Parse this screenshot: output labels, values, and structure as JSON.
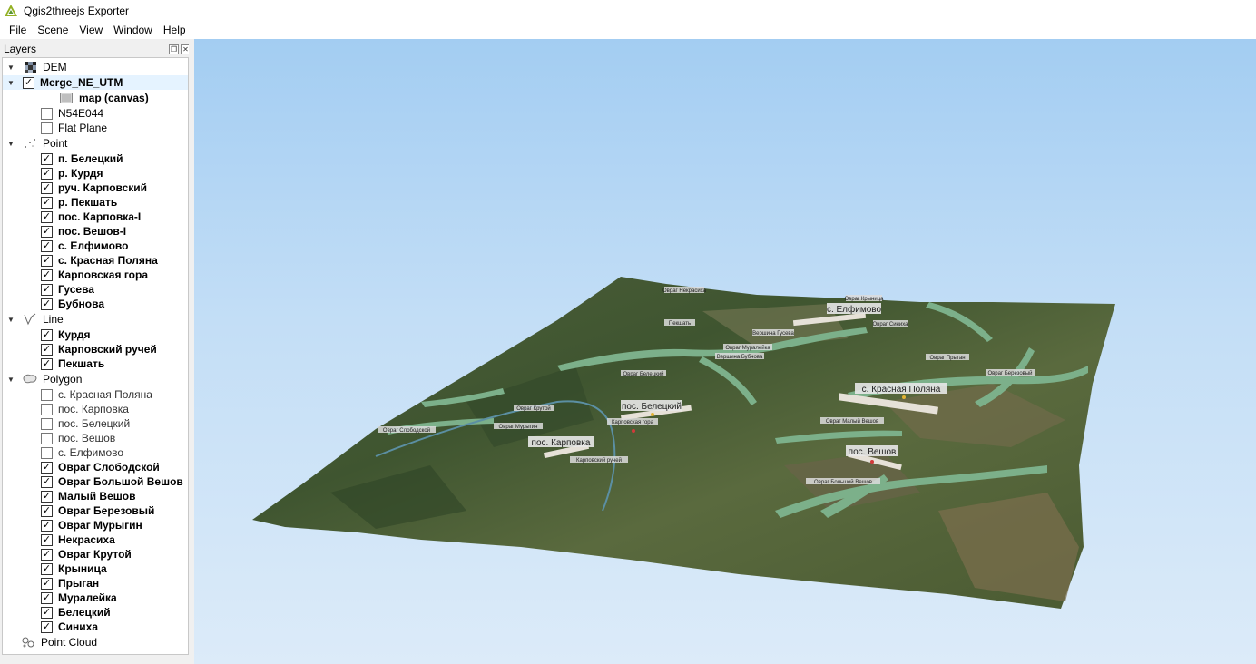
{
  "window": {
    "title": "Qgis2threejs Exporter"
  },
  "menu": [
    "File",
    "Scene",
    "View",
    "Window",
    "Help"
  ],
  "layers_panel": {
    "title": "Layers",
    "groups": {
      "dem": {
        "label": "DEM",
        "layers": [
          {
            "label": "Merge_NE_UTM",
            "checked": true,
            "bold": true,
            "selected": true
          },
          {
            "label": "map (canvas)",
            "bold": true,
            "child": true
          },
          {
            "label": "N54E044",
            "checked": false
          },
          {
            "label": "Flat Plane",
            "checked": false
          }
        ]
      },
      "point": {
        "label": "Point",
        "layers": [
          {
            "label": "п. Белецкий",
            "checked": true
          },
          {
            "label": "р. Курдя",
            "checked": true
          },
          {
            "label": "руч. Карповский",
            "checked": true
          },
          {
            "label": "р. Пекшать",
            "checked": true
          },
          {
            "label": "пос. Карповка-I",
            "checked": true
          },
          {
            "label": "пос. Вешов-I",
            "checked": true
          },
          {
            "label": "с. Елфимово",
            "checked": true
          },
          {
            "label": "с. Красная Поляна",
            "checked": true
          },
          {
            "label": "Карповская гора",
            "checked": true
          },
          {
            "label": "Гусева",
            "checked": true
          },
          {
            "label": "Бубнова",
            "checked": true
          }
        ]
      },
      "line": {
        "label": "Line",
        "layers": [
          {
            "label": "Курдя",
            "checked": true
          },
          {
            "label": "Карповский ручей",
            "checked": true
          },
          {
            "label": "Пекшать",
            "checked": true
          }
        ]
      },
      "polygon": {
        "label": "Polygon",
        "layers": [
          {
            "label": "с. Красная Поляна",
            "checked": false
          },
          {
            "label": "пос. Карповка",
            "checked": false
          },
          {
            "label": "пос. Белецкий",
            "checked": false
          },
          {
            "label": "пос. Вешов",
            "checked": false
          },
          {
            "label": "с. Елфимово",
            "checked": false
          },
          {
            "label": "Овраг Слободской",
            "checked": true
          },
          {
            "label": "Овраг Большой Вешов",
            "checked": true
          },
          {
            "label": "Малый Вешов",
            "checked": true
          },
          {
            "label": "Овраг Березовый",
            "checked": true
          },
          {
            "label": "Овраг Мурыгин",
            "checked": true
          },
          {
            "label": "Некрасиха",
            "checked": true
          },
          {
            "label": "Овраг Крутой",
            "checked": true
          },
          {
            "label": "Крыница",
            "checked": true
          },
          {
            "label": "Прыган",
            "checked": true
          },
          {
            "label": "Муралейка",
            "checked": true
          },
          {
            "label": "Белецкий",
            "checked": true
          },
          {
            "label": "Синиха",
            "checked": true
          }
        ]
      },
      "point_cloud": {
        "label": "Point Cloud"
      }
    }
  },
  "scene_labels": {
    "big": [
      "с. Елфимово",
      "пос. Белецкий",
      "с. Красная Поляна",
      "пос. Карповка",
      "пос. Вешов"
    ],
    "small": [
      "Овраг Некрасиха",
      "Овраг Крыница",
      "Овраг Синиха",
      "Пекшать",
      "Вершина Гусева",
      "Овраг Муралейка",
      "Вершина Бубнова",
      "Овраг Прыган",
      "Овраг Березовый",
      "Овраг Белецкий",
      "Овраг Крутой",
      "Карповская гора",
      "Овраг Мурыгин",
      "Овраг Слободской",
      "Овраг Малый Вешов",
      "Карповский ручей",
      "Овраг Большой Вешов"
    ]
  }
}
